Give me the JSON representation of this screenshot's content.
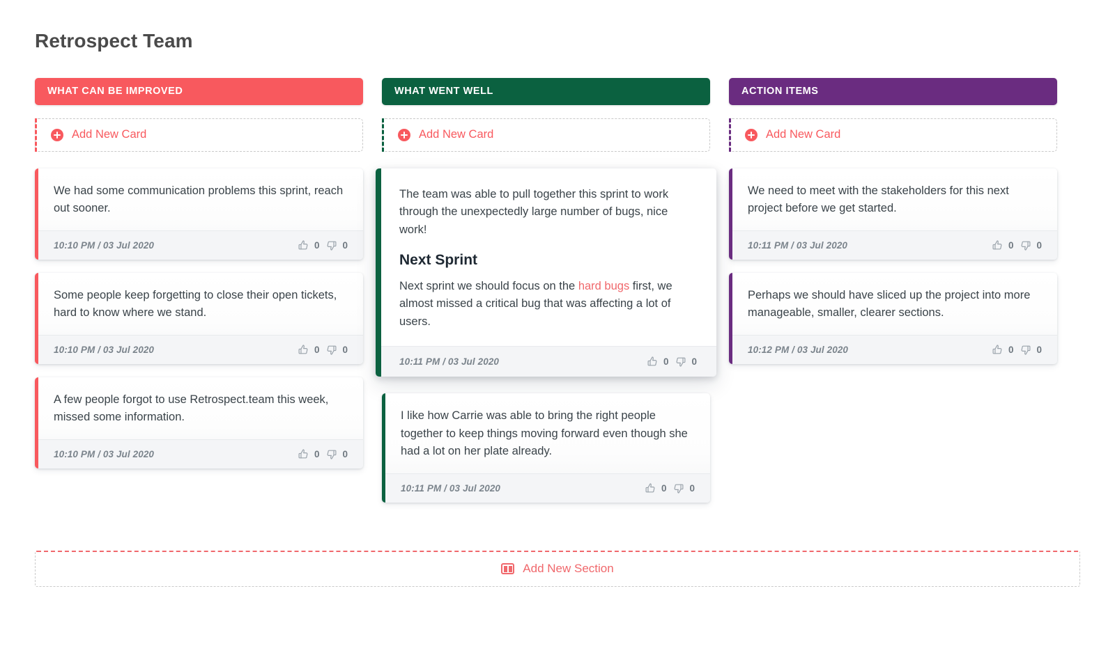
{
  "board": {
    "title": "Retrospect Team"
  },
  "colors": {
    "improved": "#f8595e",
    "went_well": "#0b6140",
    "action_items": "#6a2c80",
    "link": "#f0686c",
    "accent": "#f8595e"
  },
  "add_card_label": "Add New Card",
  "add_section": {
    "label": "Add New Section",
    "icon": "columns-icon"
  },
  "icons": {
    "add": "plus-circle-icon",
    "thumbs_up": "thumbs-up-icon",
    "thumbs_down": "thumbs-down-icon"
  },
  "columns": [
    {
      "id": "what-can-be-improved",
      "header": "WHAT CAN BE IMPROVED",
      "color": "#f8595e",
      "add_card_label": "Add New Card",
      "cards": [
        {
          "text": "We had some communication problems this sprint, reach out sooner.",
          "time": "10:10 PM / 03 Jul 2020",
          "up": "0",
          "down": "0",
          "highlight": false
        },
        {
          "text": "Some people keep forgetting to close their open tickets, hard to know where we stand.",
          "time": "10:10 PM / 03 Jul 2020",
          "up": "0",
          "down": "0",
          "highlight": false
        },
        {
          "text": "A few people forgot to use Retrospect.team this week, missed some information.",
          "time": "10:10 PM / 03 Jul 2020",
          "up": "0",
          "down": "0",
          "highlight": false
        }
      ]
    },
    {
      "id": "what-went-well",
      "header": "WHAT WENT WELL",
      "color": "#0b6140",
      "add_card_label": "Add New Card",
      "cards": [
        {
          "text": "The team was able to pull together this sprint to work through the unexpectedly large number of bugs, nice work!",
          "heading": "Next Sprint",
          "text2_before": "Next sprint we should focus on the ",
          "text2_link": "hard bugs",
          "text2_after": " first, we almost missed a critical bug that was affecting a lot of users.",
          "time": "10:11 PM / 03 Jul 2020",
          "up": "0",
          "down": "0",
          "highlight": true
        },
        {
          "text": "I like how Carrie was able to bring the right people together to keep things moving forward even though she had a lot on her plate already.",
          "time": "10:11 PM / 03 Jul 2020",
          "up": "0",
          "down": "0",
          "highlight": false
        }
      ]
    },
    {
      "id": "action-items",
      "header": "ACTION ITEMS",
      "color": "#6a2c80",
      "add_card_label": "Add New Card",
      "cards": [
        {
          "text": "We need to meet with the stakeholders for this next project before we get started.",
          "time": "10:11 PM / 03 Jul 2020",
          "up": "0",
          "down": "0",
          "highlight": false
        },
        {
          "text": "Perhaps we should have sliced up the project into more manageable, smaller, clearer sections.",
          "time": "10:12 PM / 03 Jul 2020",
          "up": "0",
          "down": "0",
          "highlight": false
        }
      ]
    }
  ]
}
